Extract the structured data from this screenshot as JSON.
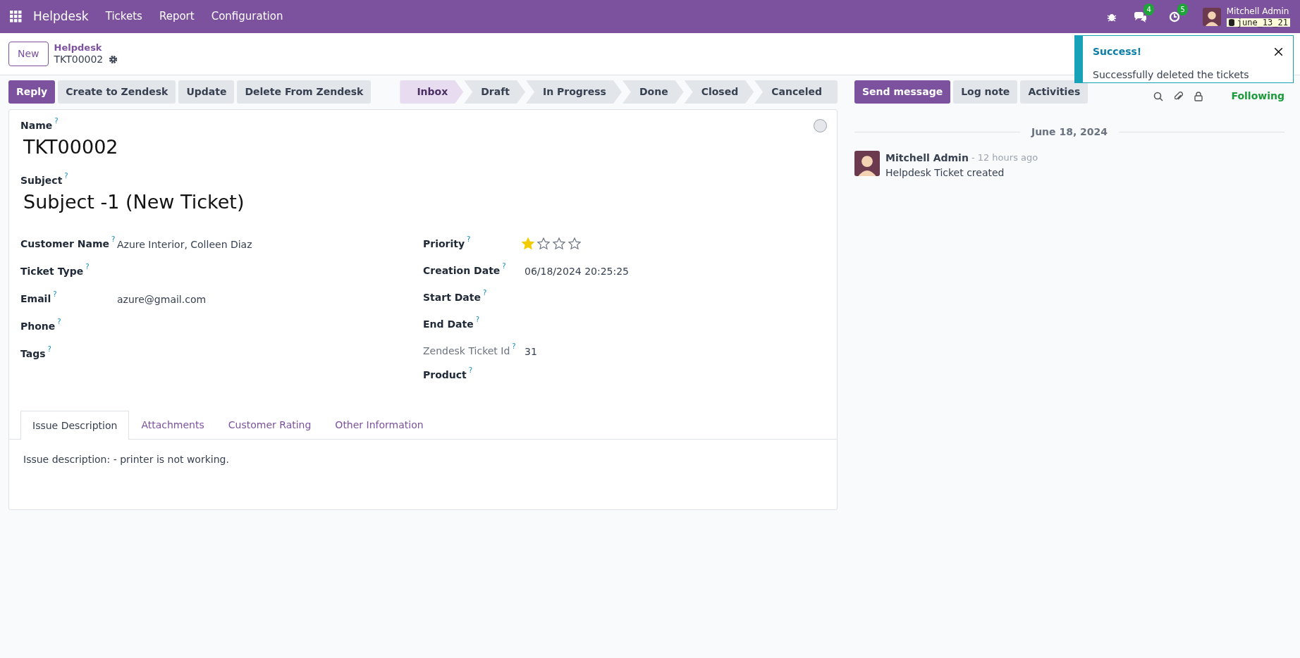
{
  "navbar": {
    "app": "Helpdesk",
    "menus": [
      "Tickets",
      "Report",
      "Configuration"
    ],
    "badges": [
      {
        "kind": "chat",
        "count": "4"
      },
      {
        "kind": "activity",
        "count": "5"
      }
    ],
    "user": "Mitchell Admin",
    "database": "june_13_21"
  },
  "breadcrumb": {
    "new_button": "New",
    "parent": "Helpdesk",
    "current": "TKT00002"
  },
  "actions": [
    {
      "label": "Reply",
      "primary": true
    },
    {
      "label": "Create to Zendesk",
      "primary": false
    },
    {
      "label": "Update",
      "primary": false
    },
    {
      "label": "Delete From Zendesk",
      "primary": false
    }
  ],
  "stages": [
    {
      "label": "Inbox",
      "selected": true
    },
    {
      "label": "Draft",
      "selected": false
    },
    {
      "label": "In Progress",
      "selected": false
    },
    {
      "label": "Done",
      "selected": false
    },
    {
      "label": "Closed",
      "selected": false
    },
    {
      "label": "Canceled",
      "selected": false
    }
  ],
  "form": {
    "name_label": "Name",
    "name_help": "?",
    "name": "TKT00002",
    "subject_label": "Subject",
    "subject_help": "?",
    "subject": "Subject -1 (New Ticket)",
    "left_fields": [
      {
        "label": "Customer Name",
        "help": "?",
        "value": "Azure Interior, Colleen Diaz",
        "readonly": false
      },
      {
        "label": "Ticket Type",
        "help": "?",
        "readonly": false
      },
      {
        "label": "Email",
        "help": "?",
        "value": "azure@gmail.com",
        "readonly": false
      },
      {
        "label": "Phone",
        "help": "?",
        "readonly": false
      },
      {
        "label": "Tags",
        "help": "?",
        "readonly": false
      }
    ],
    "right_fields": [
      {
        "label": "Priority",
        "help": "?",
        "kind": "stars",
        "stars": 1,
        "readonly": false
      },
      {
        "label": "Creation Date",
        "help": "?",
        "kind": "text",
        "value": "06/18/2024 20:25:25",
        "readonly": false
      },
      {
        "label": "Start Date",
        "help": "?",
        "kind": "text",
        "readonly": false
      },
      {
        "label": "End Date",
        "help": "?",
        "kind": "text",
        "readonly": false
      },
      {
        "label": "Zendesk Ticket Id",
        "help": "?",
        "kind": "text",
        "value": "31",
        "readonly": true
      },
      {
        "label": "Product",
        "help": "?",
        "kind": "text",
        "readonly": false
      }
    ],
    "tabs": [
      {
        "label": "Issue Description",
        "selected": true
      },
      {
        "label": "Attachments",
        "selected": false
      },
      {
        "label": "Customer Rating",
        "selected": false
      },
      {
        "label": "Other Information",
        "selected": false
      }
    ],
    "description": "Issue description: - printer is not working."
  },
  "chatter": {
    "buttons": [
      {
        "label": "Send message",
        "primary": true
      },
      {
        "label": "Log note",
        "primary": false
      },
      {
        "label": "Activities",
        "primary": false
      }
    ],
    "following": "Following",
    "date": "June 18, 2024",
    "messages": [
      {
        "author": "Mitchell Admin",
        "time": "- 12 hours ago",
        "body": "Helpdesk Ticket created"
      }
    ]
  },
  "toast": {
    "title": "Success!",
    "message": "Successfully deleted the tickets"
  }
}
